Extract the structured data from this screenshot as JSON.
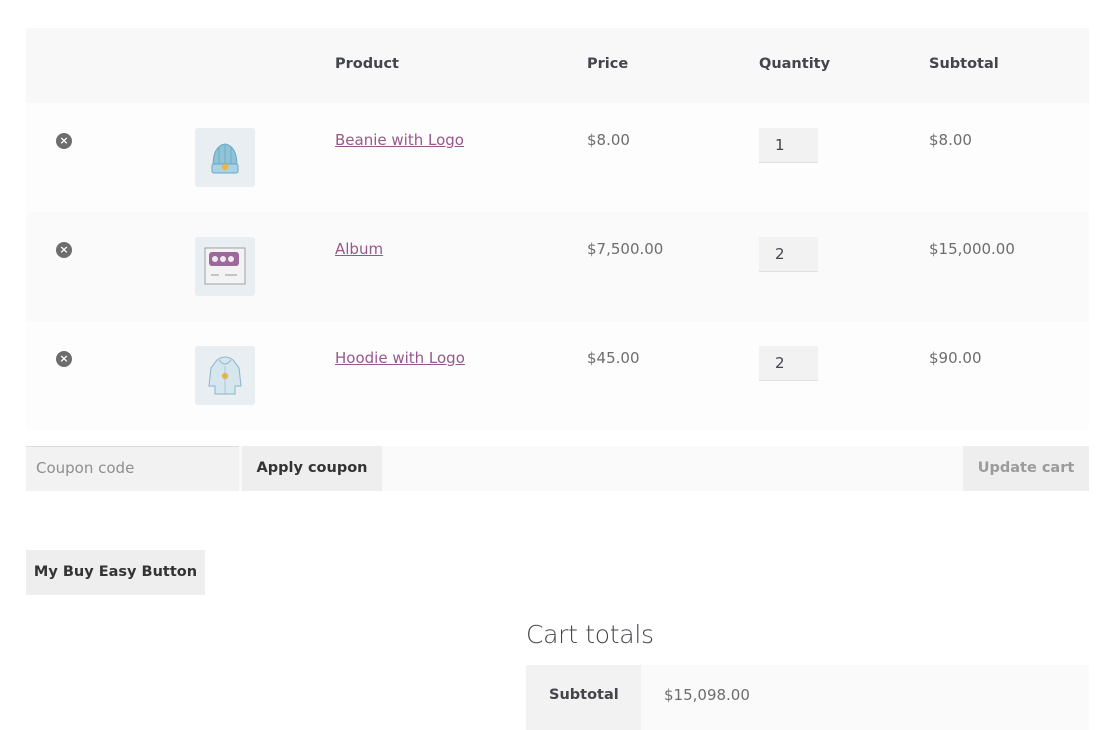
{
  "table": {
    "headers": {
      "product": "Product",
      "price": "Price",
      "quantity": "Quantity",
      "subtotal": "Subtotal"
    },
    "rows": [
      {
        "remove_icon": "remove-circle-icon",
        "image_icon": "beanie-thumbnail",
        "name": "Beanie with Logo",
        "price": "$8.00",
        "quantity": "1",
        "subtotal": "$8.00"
      },
      {
        "remove_icon": "remove-circle-icon",
        "image_icon": "album-thumbnail",
        "name": "Album",
        "price": "$7,500.00",
        "quantity": "2",
        "subtotal": "$15,000.00"
      },
      {
        "remove_icon": "remove-circle-icon",
        "image_icon": "hoodie-thumbnail",
        "name": "Hoodie with Logo",
        "price": "$45.00",
        "quantity": "2",
        "subtotal": "$90.00"
      }
    ]
  },
  "actions": {
    "coupon_placeholder": "Coupon code",
    "apply_label": "Apply coupon",
    "update_label": "Update cart"
  },
  "buy_button_label": "My Buy Easy Button",
  "totals": {
    "title": "Cart totals",
    "subtotal_label": "Subtotal",
    "subtotal_value": "$15,098.00"
  },
  "colors": {
    "link": "#96588a",
    "header_bg": "#f8f8f8",
    "button_bg": "#eeeeee"
  }
}
